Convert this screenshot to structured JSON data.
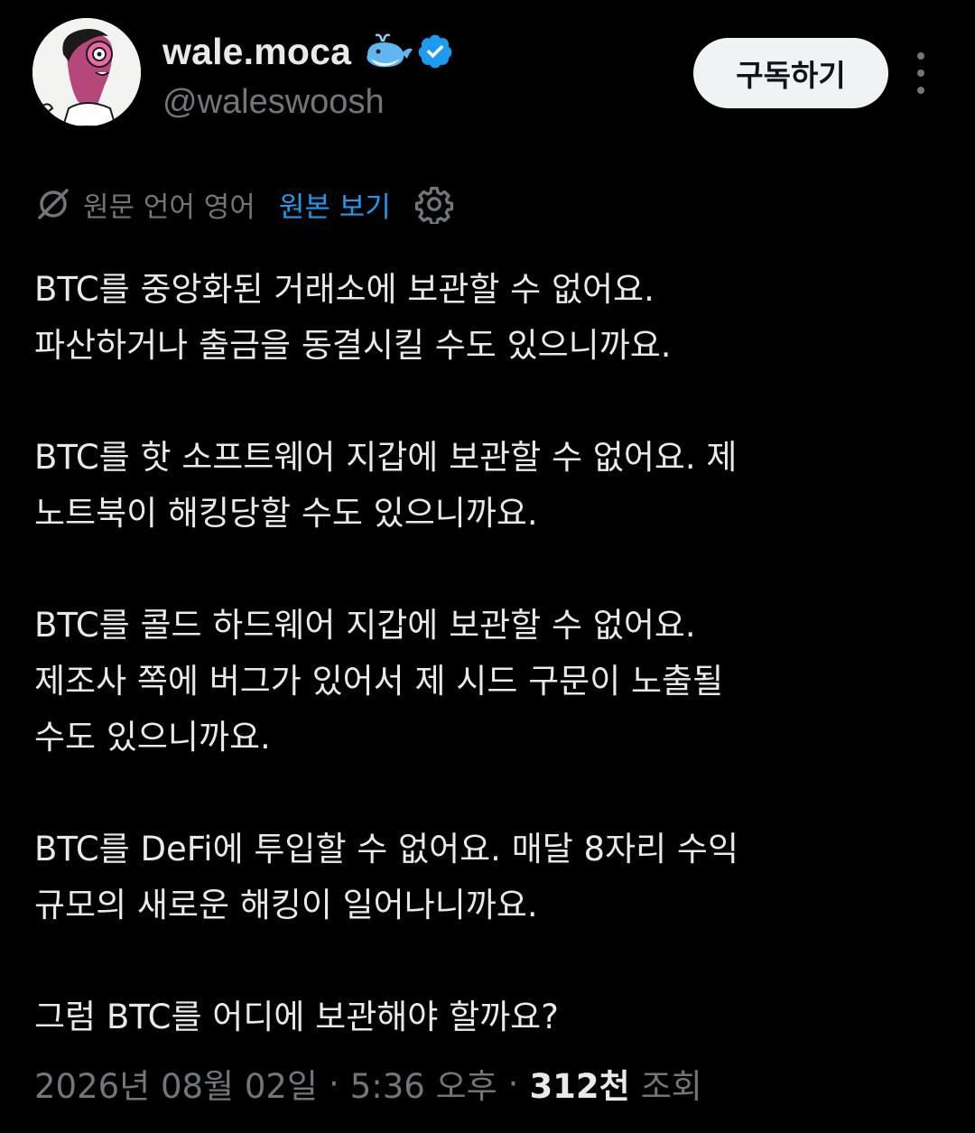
{
  "author": {
    "display_name": "wale.moca",
    "handle": "@waleswoosh",
    "badge_icons": [
      "whale-emoji",
      "verified-badge"
    ],
    "avatar": "cartoon-avatar"
  },
  "actions": {
    "subscribe_label": "구독하기",
    "more_icon": "more-vertical-icon"
  },
  "translation_bar": {
    "icon": "no-translate-icon",
    "label": "원문 언어 영어",
    "show_original_label": "원본 보기",
    "settings_icon": "gear-icon"
  },
  "tweet": {
    "paragraphs": [
      [
        "BTC를 중앙화된 거래소에 보관할 수 없어요.",
        "파산하거나 출금을 동결시킬 수도 있으니까요."
      ],
      [
        "BTC를 핫 소프트웨어 지갑에 보관할 수 없어요. 제",
        "노트북이 해킹당할 수도 있으니까요."
      ],
      [
        "BTC를 콜드 하드웨어 지갑에 보관할 수 없어요.",
        "제조사 쪽에 버그가 있어서 제 시드 구문이 노출될",
        "수도 있으니까요."
      ],
      [
        "BTC를 DeFi에 투입할 수 없어요. 매달 8자리 수익",
        "규모의 새로운 해킹이 일어나니까요."
      ],
      [
        "그럼 BTC를 어디에 보관해야 할까요?"
      ]
    ]
  },
  "meta": {
    "date": "2026년 08월 02일",
    "separator": "·",
    "time": "5:36 오후",
    "views_count": "312천",
    "views_label": "조회"
  },
  "colors": {
    "background": "#000000",
    "text_primary": "#e7e9ea",
    "text_secondary": "#71767b",
    "link": "#1d9bf0",
    "button_bg": "#eff3f4"
  }
}
